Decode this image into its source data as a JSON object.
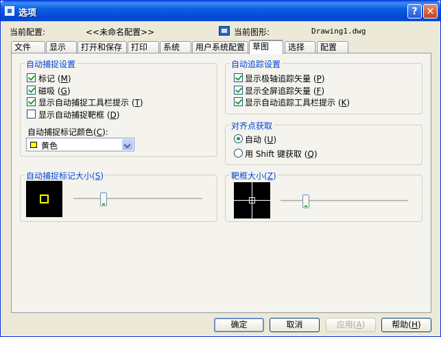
{
  "window": {
    "title": "选项"
  },
  "profile": {
    "label": "当前配置:",
    "value": "<<未命名配置>>"
  },
  "drawing": {
    "label": "当前图形:",
    "value": "Drawing1.dwg"
  },
  "tabs": [
    "文件",
    "显示",
    "打开和保存",
    "打印",
    "系统",
    "用户系统配置",
    "草图",
    "选择",
    "配置"
  ],
  "active_tab": "草图",
  "autosnap": {
    "title": "自动捕捉设置",
    "options": [
      {
        "label": "标记",
        "key": "M",
        "checked": true
      },
      {
        "label": "磁吸",
        "key": "G",
        "checked": true
      },
      {
        "label": "显示自动捕捉工具栏提示",
        "key": "T",
        "checked": true
      },
      {
        "label": "显示自动捕捉靶框",
        "key": "D",
        "checked": false
      }
    ],
    "color_label": "自动捕捉标记颜色",
    "color_key": "C",
    "color_value": "黄色",
    "color_hex": "#ffff00"
  },
  "autotrack": {
    "title": "自动追踪设置",
    "options": [
      {
        "label": "显示极轴追踪矢量",
        "key": "P",
        "checked": true
      },
      {
        "label": "显示全屏追踪矢量",
        "key": "F",
        "checked": true
      },
      {
        "label": "显示自动追踪工具栏提示",
        "key": "K",
        "checked": true
      }
    ]
  },
  "alignment": {
    "title": "对齐点获取",
    "options": [
      {
        "label": "自动",
        "key": "U",
        "selected": true
      },
      {
        "label": "用 Shift 键获取",
        "key": "Q",
        "selected": false
      }
    ]
  },
  "marker_size": {
    "title": "自动捕捉标记大小",
    "key": "S",
    "level": 0.22
  },
  "aperture_size": {
    "title": "靶框大小",
    "key": "Z",
    "level": 0.18
  },
  "buttons": {
    "ok": "确定",
    "cancel": "取消",
    "apply": "应用",
    "apply_key": "A",
    "help": "帮助",
    "help_key": "H"
  }
}
